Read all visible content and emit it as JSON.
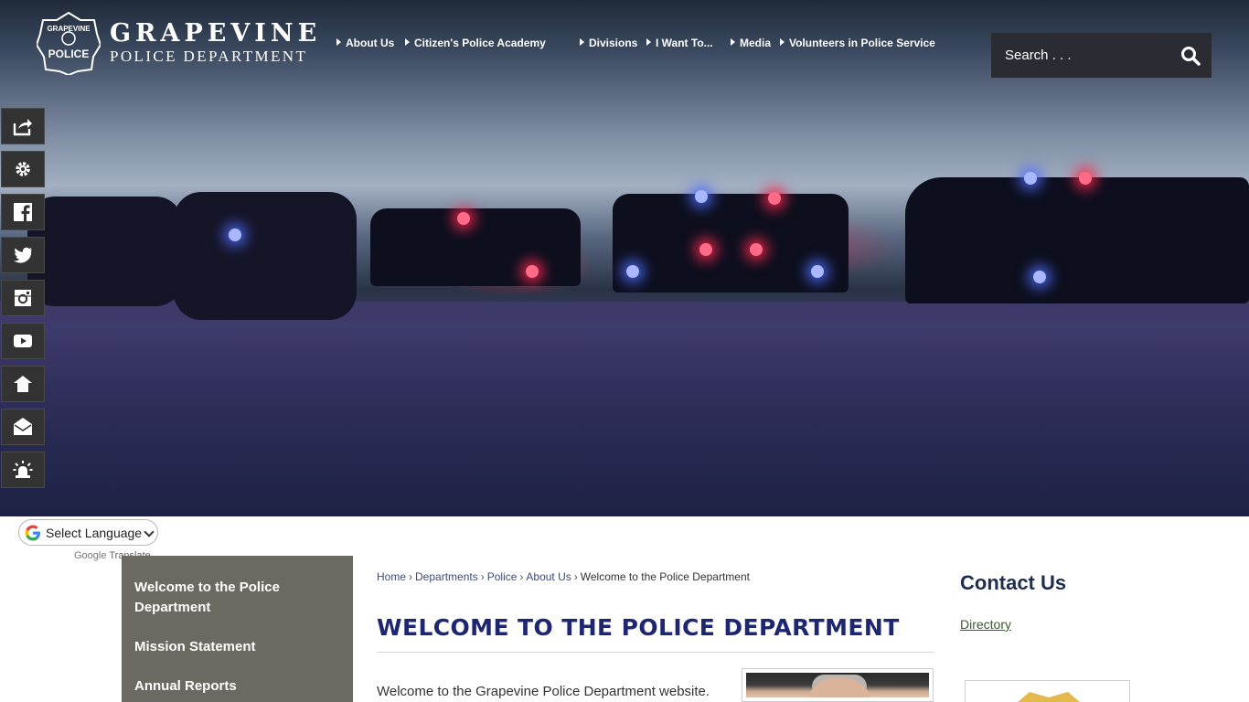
{
  "header": {
    "logo_main": "GRAPEVINE",
    "logo_sub": "POLICE DEPARTMENT",
    "badge_top": "GRAPEVINE",
    "badge_bottom": "POLICE"
  },
  "nav": {
    "items": [
      {
        "label": "About Us"
      },
      {
        "label": "Citizen's Police Academy"
      },
      {
        "label": "Divisions"
      },
      {
        "label": "I Want To..."
      },
      {
        "label": "Media"
      },
      {
        "label": "Volunteers in Police Service"
      }
    ]
  },
  "search": {
    "placeholder": "Search . . .",
    "icon": "search-icon"
  },
  "side_toolbar": {
    "icons": [
      "share-icon",
      "gear-icon",
      "facebook-icon",
      "twitter-icon",
      "instagram-icon",
      "youtube-icon",
      "nextdoor-icon",
      "email-icon",
      "alert-siren-icon"
    ]
  },
  "translate": {
    "label": "Select Language",
    "powered_by_brand": "Google",
    "powered_by_word": "Translate"
  },
  "subnav": {
    "items": [
      {
        "label": "Welcome to the Police Department"
      },
      {
        "label": "Mission Statement"
      },
      {
        "label": "Annual Reports"
      }
    ]
  },
  "breadcrumb": {
    "items": [
      "Home",
      "Departments",
      "Police",
      "About Us"
    ],
    "current": "Welcome to the Police Department",
    "separator": "›"
  },
  "main": {
    "title": "WELCOME TO THE POLICE DEPARTMENT",
    "intro": "Welcome to the Grapevine Police Department website."
  },
  "sidebar_right": {
    "contact_title": "Contact Us",
    "directory_link": "Directory"
  },
  "colors": {
    "title_navy": "#1f2670",
    "subnav_bg": "#6b6a62",
    "toolbar_bg": "#333333",
    "search_bg": "#2b2c33"
  }
}
